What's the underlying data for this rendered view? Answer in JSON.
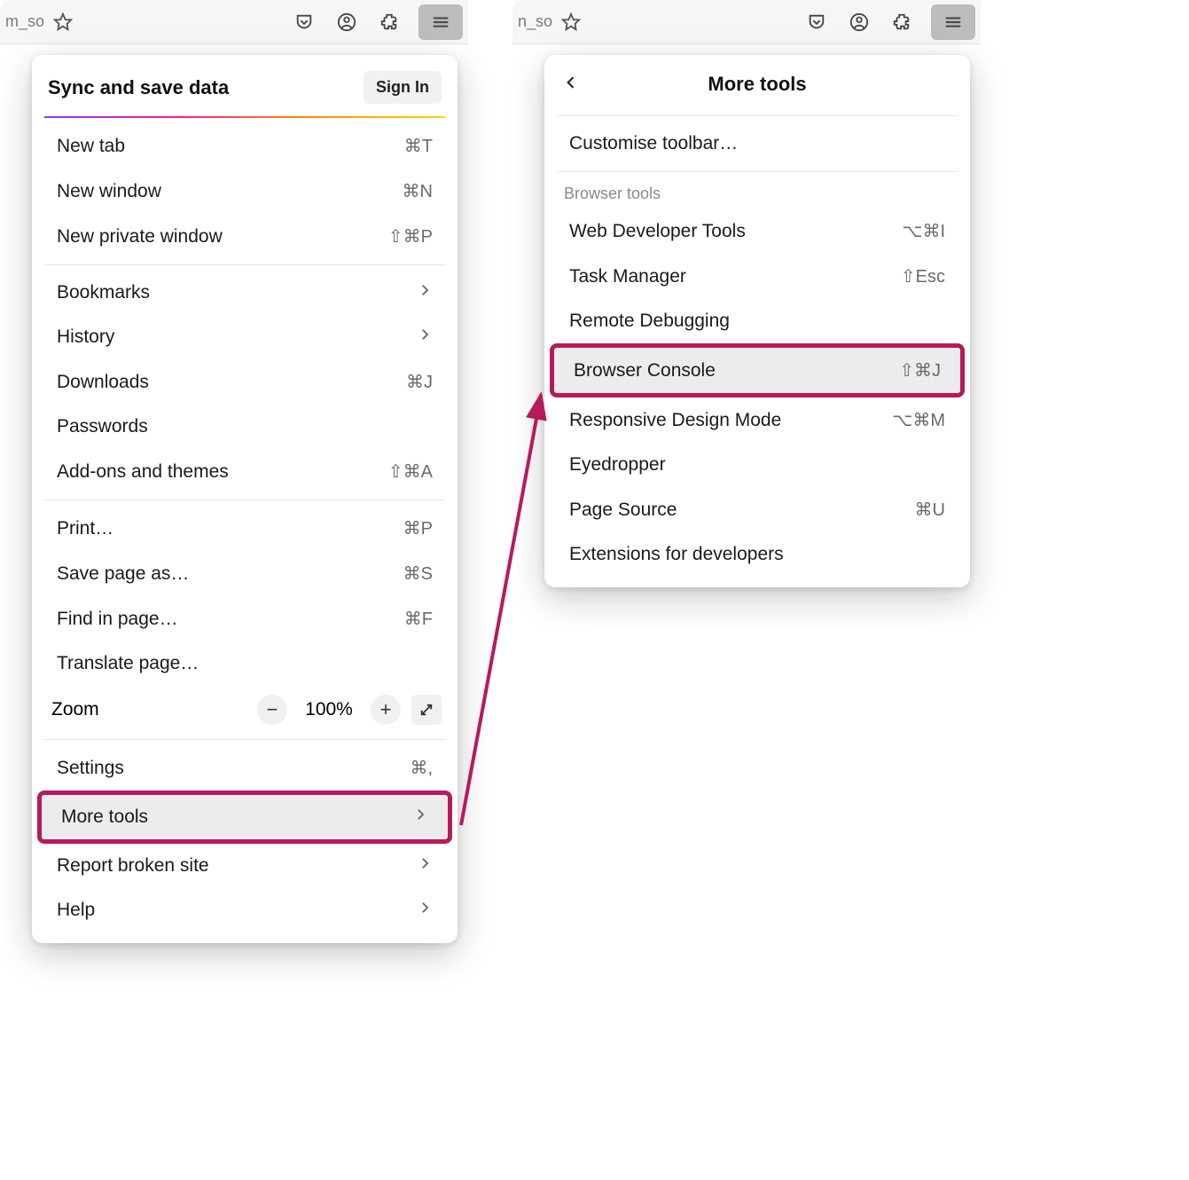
{
  "left": {
    "tabText": "m_so",
    "sync": {
      "title": "Sync and save data",
      "signin": "Sign In"
    },
    "items1": [
      {
        "label": "New tab",
        "shortcut": "⌘T"
      },
      {
        "label": "New window",
        "shortcut": "⌘N"
      },
      {
        "label": "New private window",
        "shortcut": "⇧⌘P"
      }
    ],
    "items2": [
      {
        "label": "Bookmarks",
        "chevron": true
      },
      {
        "label": "History",
        "chevron": true
      },
      {
        "label": "Downloads",
        "shortcut": "⌘J"
      },
      {
        "label": "Passwords"
      },
      {
        "label": "Add-ons and themes",
        "shortcut": "⇧⌘A"
      }
    ],
    "items3": [
      {
        "label": "Print…",
        "shortcut": "⌘P"
      },
      {
        "label": "Save page as…",
        "shortcut": "⌘S"
      },
      {
        "label": "Find in page…",
        "shortcut": "⌘F"
      },
      {
        "label": "Translate page…"
      }
    ],
    "zoom": {
      "label": "Zoom",
      "value": "100%"
    },
    "items4": [
      {
        "label": "Settings",
        "shortcut": "⌘,"
      }
    ],
    "moretools": {
      "label": "More tools"
    },
    "items5": [
      {
        "label": "Report broken site",
        "chevron": true
      },
      {
        "label": "Help",
        "chevron": true
      }
    ]
  },
  "right": {
    "tabText": "n_so",
    "title": "More tools",
    "customize": "Customise toolbar…",
    "sectionLabel": "Browser tools",
    "tools": [
      {
        "label": "Web Developer Tools",
        "shortcut": "⌥⌘I"
      },
      {
        "label": "Task Manager",
        "shortcut": "⇧Esc"
      },
      {
        "label": "Remote Debugging"
      }
    ],
    "highlighted": {
      "label": "Browser Console",
      "shortcut": "⇧⌘J"
    },
    "tools2": [
      {
        "label": "Responsive Design Mode",
        "shortcut": "⌥⌘M"
      },
      {
        "label": "Eyedropper"
      },
      {
        "label": "Page Source",
        "shortcut": "⌘U"
      },
      {
        "label": "Extensions for developers"
      }
    ]
  }
}
